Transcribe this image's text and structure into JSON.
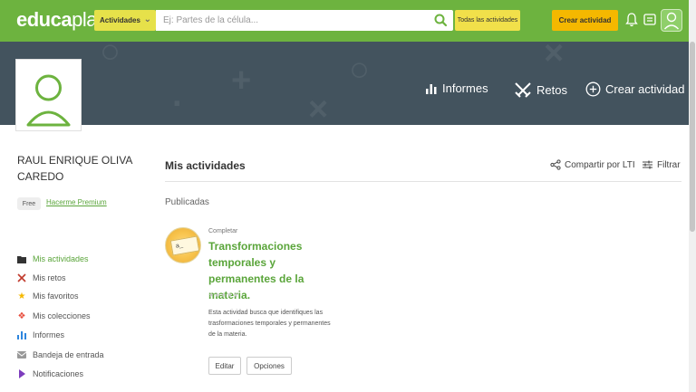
{
  "header": {
    "logo_bold": "educa",
    "logo_light": "play",
    "activities_dropdown": "Actividades",
    "search_placeholder": "Ej: Partes de la célula...",
    "all_activities_button": "Todas las actividades",
    "create_activity_button": "Crear actividad"
  },
  "banner": {
    "nav": [
      {
        "label": "Informes",
        "icon": "bar-chart-icon"
      },
      {
        "label": "Retos",
        "icon": "swords-icon"
      },
      {
        "label": "Crear actividad",
        "icon": "plus-circle-icon"
      }
    ]
  },
  "user": {
    "name": "RAUL ENRIQUE OLIVA CAREDO",
    "plan": "Free",
    "premium_link": "Hacerme Premium"
  },
  "sidebar": {
    "items": [
      {
        "label": "Mis actividades",
        "icon": "folder-icon",
        "color": "#333333",
        "active": true
      },
      {
        "label": "Mis retos",
        "icon": "swords-icon",
        "color": "#c0392b"
      },
      {
        "label": "Mis favoritos",
        "icon": "star-icon",
        "color": "#f5b800"
      },
      {
        "label": "Mis colecciones",
        "icon": "collection-icon",
        "color": "#e74c3c"
      },
      {
        "label": "Informes",
        "icon": "bar-chart-icon",
        "color": "#2e86de"
      },
      {
        "label": "Bandeja de entrada",
        "icon": "inbox-icon",
        "color": "#999999"
      },
      {
        "label": "Notificaciones",
        "icon": "bell-icon",
        "color": "#7d3cbd"
      }
    ]
  },
  "main": {
    "title": "Mis actividades",
    "share_label": "Compartir por LTI",
    "filter_label": "Filtrar",
    "tab": "Publicadas",
    "activity": {
      "type": "Completar",
      "thumb_text": "a_",
      "title": "Transformaciones temporales y permanentes de la materia.",
      "stars": "★★★★★",
      "description": "Esta actividad busca que identifiques las trasformaciones temporales y permanentes de la materia.",
      "edit_button": "Editar",
      "options_button": "Opciones"
    }
  },
  "colors": {
    "top_bar": "#6db33f",
    "banner": "#43535e",
    "accent_green": "#5aa53a",
    "yellow_button": "#f1e04a",
    "orange_button": "#f5b800"
  }
}
